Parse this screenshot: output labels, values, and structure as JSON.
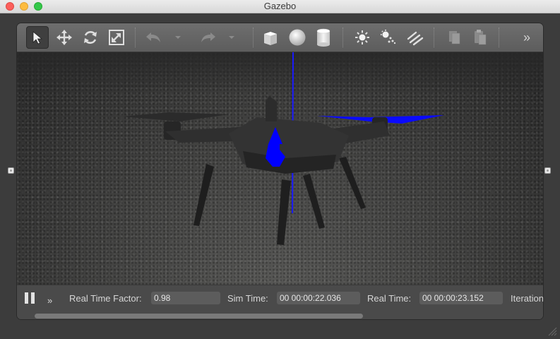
{
  "window": {
    "title": "Gazebo"
  },
  "toolbar": {
    "tools": [
      "select",
      "translate",
      "rotate",
      "scale",
      "undo",
      "redo",
      "box",
      "sphere",
      "cylinder",
      "point-light",
      "spot-light",
      "directional-light",
      "copy",
      "paste"
    ],
    "overflow_label": "»"
  },
  "viewport": {
    "model": "quadcopter-drone",
    "axis_color": "#0000ff"
  },
  "bottombar": {
    "overflow_label": "»",
    "real_time_factor_label": "Real Time Factor:",
    "real_time_factor_value": "0.98",
    "sim_time_label": "Sim Time:",
    "sim_time_value": "00 00:00:22.036",
    "real_time_label": "Real Time:",
    "real_time_value": "00 00:00:23.152",
    "iterations_label": "Iterations:"
  },
  "colors": {
    "accent_blue": "#0000ff",
    "toolbar_bg": "#666666",
    "body_bg": "#3c3c3c"
  }
}
